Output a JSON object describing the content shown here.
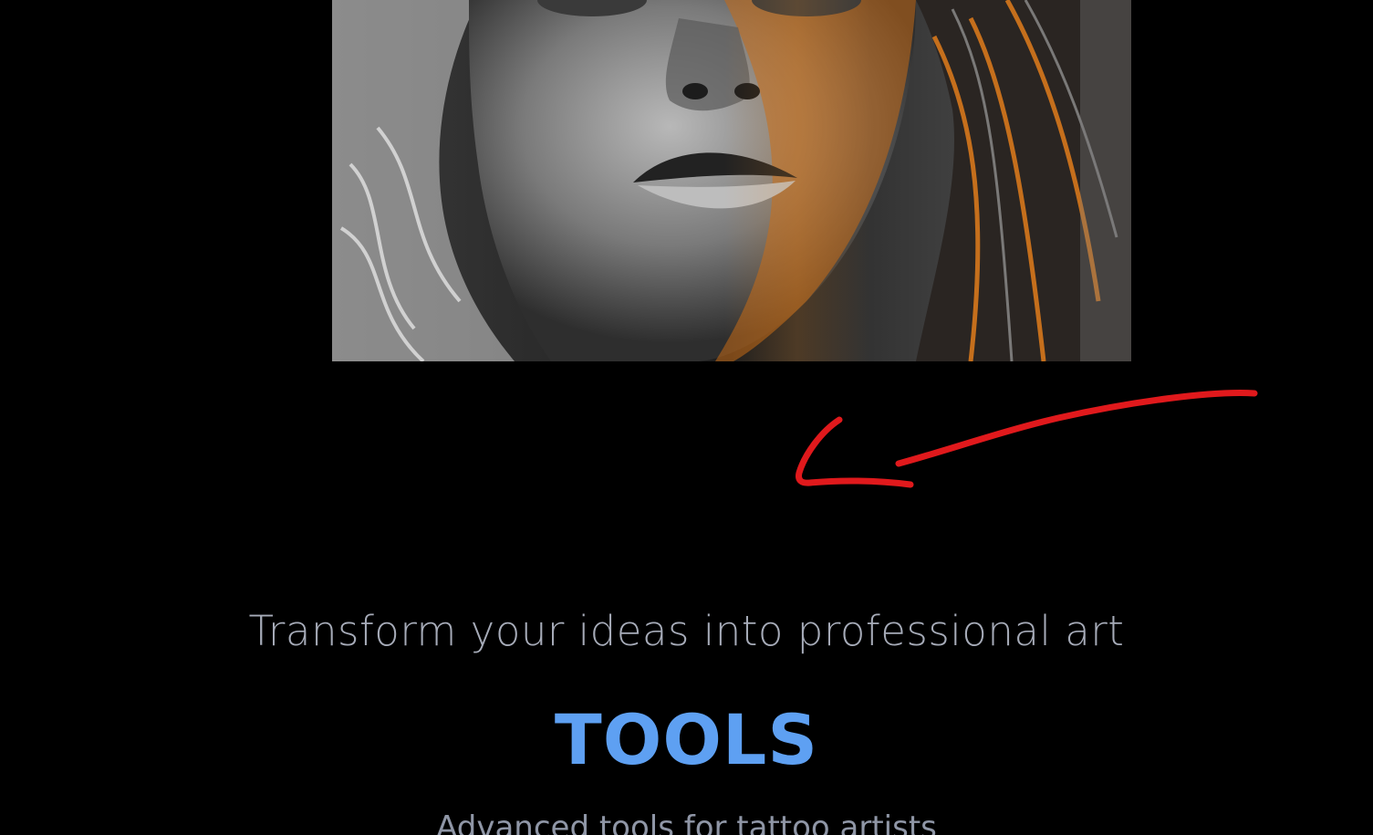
{
  "hero": {
    "image_alt": "Black and white portrait of a woman with orange-lit hair"
  },
  "intro": {
    "tagline": "Transform your ideas into professional art"
  },
  "tools_section": {
    "title": "TOOLS",
    "subtitle": "Advanced tools for tattoo artists"
  },
  "colors": {
    "background": "#000000",
    "tagline": "#a6abb8",
    "title": "#5ea0f2",
    "subtitle": "#8f96a6",
    "annotation": "#e0191c",
    "image_glow": "#f08a1c"
  },
  "annotation": {
    "icon": "arrow-left-handdrawn"
  }
}
